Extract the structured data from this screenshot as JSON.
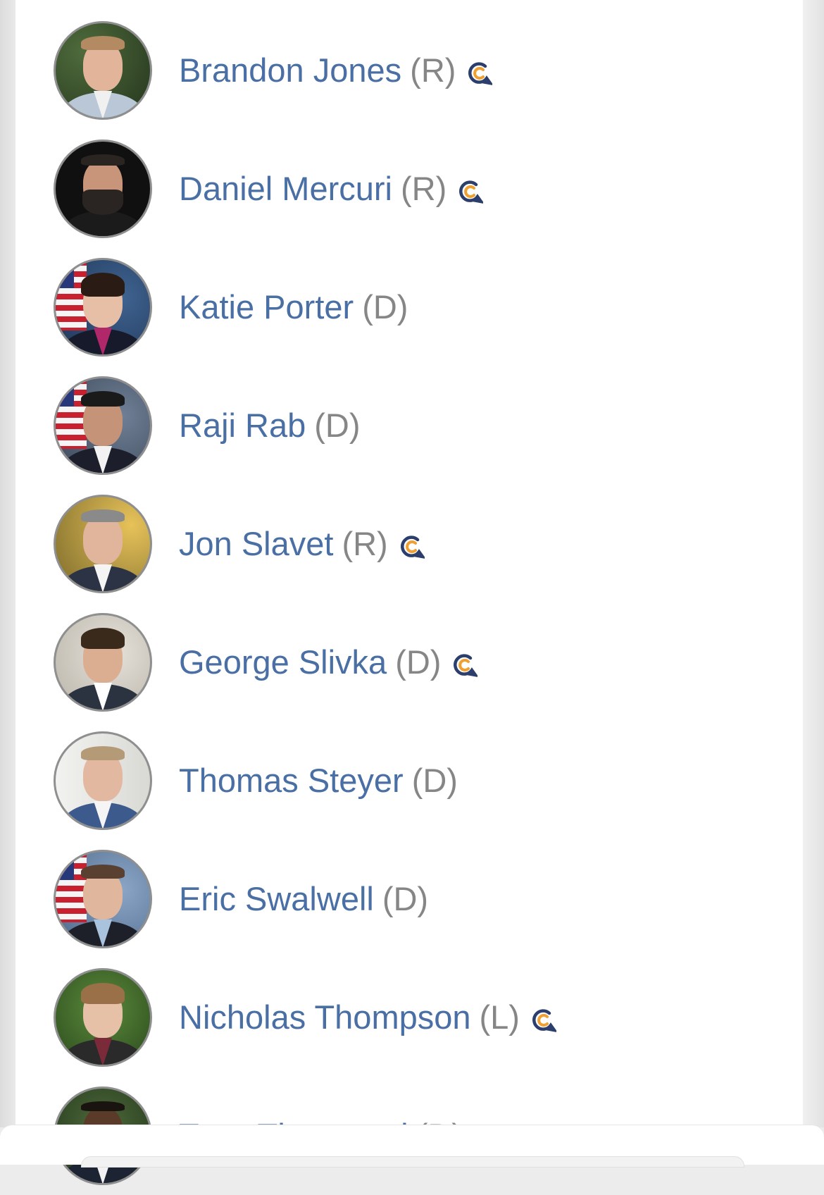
{
  "colors": {
    "name_link": "#4a6fa5",
    "party_text": "#868686",
    "badge_navy": "#2c3e6b",
    "badge_orange": "#f0a030",
    "avatar_ring": "#8f8f8f"
  },
  "candidates": [
    {
      "name": "Brandon Jones",
      "party": "(R)",
      "badge": true
    },
    {
      "name": "Daniel Mercuri",
      "party": "(R)",
      "badge": true
    },
    {
      "name": "Katie Porter",
      "party": "(D)",
      "badge": false
    },
    {
      "name": "Raji Rab",
      "party": "(D)",
      "badge": false
    },
    {
      "name": "Jon Slavet",
      "party": "(R)",
      "badge": true
    },
    {
      "name": "George Slivka",
      "party": "(D)",
      "badge": true
    },
    {
      "name": "Thomas Steyer",
      "party": "(D)",
      "badge": false
    },
    {
      "name": "Eric Swalwell",
      "party": "(D)",
      "badge": false
    },
    {
      "name": "Nicholas Thompson",
      "party": "(L)",
      "badge": true
    },
    {
      "name": "Tony Thurmond",
      "party": "(D)",
      "badge": false
    }
  ],
  "icons": {
    "avatar": "candidate-photo",
    "badge": "c-speech-bubble-icon"
  }
}
